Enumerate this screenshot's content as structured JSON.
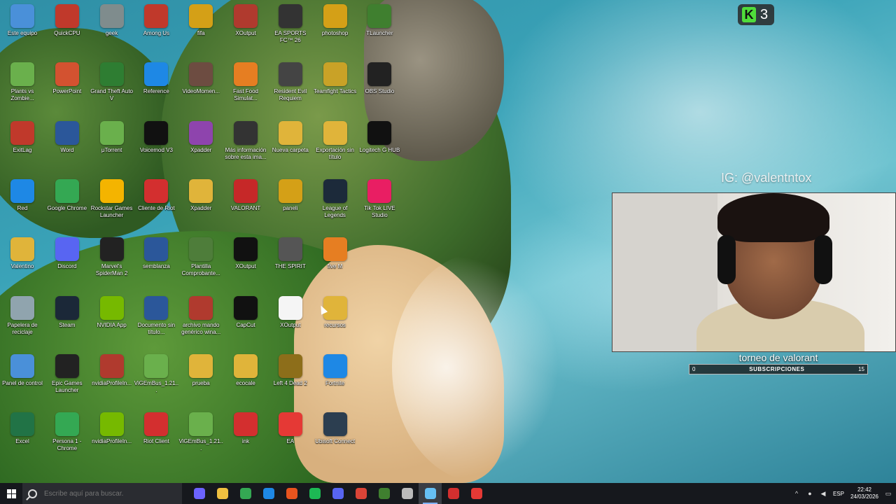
{
  "desktop": {
    "icons": [
      {
        "label": "Este equipo",
        "color": "#4a90d9",
        "icon": "computer-icon"
      },
      {
        "label": "QuickCPU",
        "color": "#c0392b",
        "icon": "quickcpu-icon"
      },
      {
        "label": "geek",
        "color": "#7f8c8d",
        "icon": "geek-icon"
      },
      {
        "label": "Among Us",
        "color": "#c0392b",
        "icon": "among-us-icon"
      },
      {
        "label": "fifa",
        "color": "#d4a017",
        "icon": "archive-icon"
      },
      {
        "label": "XOutput",
        "color": "#b03a2e",
        "icon": "archive-icon"
      },
      {
        "label": "EA SPORTS FC™ 26",
        "color": "#333333",
        "icon": "fc26-icon"
      },
      {
        "label": "photoshop",
        "color": "#d4a017",
        "icon": "archive-icon"
      },
      {
        "label": "TLauncher",
        "color": "#3f7f2f",
        "icon": "tlauncher-icon"
      },
      {
        "label": "Plants vs Zombie...",
        "color": "#6ab04c",
        "icon": "pvz-icon"
      },
      {
        "label": "PowerPoint",
        "color": "#d35230",
        "icon": "powerpoint-icon"
      },
      {
        "label": "Grand Theft Auto V",
        "color": "#2e7d32",
        "icon": "gta-icon"
      },
      {
        "label": "Reference",
        "color": "#1e88e5",
        "icon": "edge-icon"
      },
      {
        "label": "VideoMomen...",
        "color": "#6d4c41",
        "icon": "video-icon"
      },
      {
        "label": "Fast Food Simulat...",
        "color": "#e67e22",
        "icon": "game-icon"
      },
      {
        "label": "Resident Evil Requiem",
        "color": "#444444",
        "icon": "game-icon"
      },
      {
        "label": "Teamfight Tactics",
        "color": "#c9a227",
        "icon": "tft-icon"
      },
      {
        "label": "OBS Studio",
        "color": "#222222",
        "icon": "obs-icon"
      },
      {
        "label": "ExitLag",
        "color": "#c0392b",
        "icon": "exitlag-icon"
      },
      {
        "label": "Word",
        "color": "#2b579a",
        "icon": "word-icon"
      },
      {
        "label": "μTorrent",
        "color": "#6ab04c",
        "icon": "utorrent-icon"
      },
      {
        "label": "Voicemod V3",
        "color": "#111111",
        "icon": "voicemod-icon"
      },
      {
        "label": "Xpadder",
        "color": "#8e44ad",
        "icon": "archive-icon"
      },
      {
        "label": "Más información sobre esta ima...",
        "color": "#333333",
        "icon": "info-icon"
      },
      {
        "label": "Nueva carpeta",
        "color": "#e0b43a",
        "icon": "folder-icon"
      },
      {
        "label": "Exportación sin título",
        "color": "#e0b43a",
        "icon": "folder-icon"
      },
      {
        "label": "Logitech G HUB",
        "color": "#111111",
        "icon": "logitech-icon"
      },
      {
        "label": "Red",
        "color": "#1e88e5",
        "icon": "network-icon"
      },
      {
        "label": "Google Chrome",
        "color": "#34a853",
        "icon": "chrome-icon"
      },
      {
        "label": "Rockstar Games Launcher",
        "color": "#f4b400",
        "icon": "rockstar-icon"
      },
      {
        "label": "Cliente de Riot",
        "color": "#d32f2f",
        "icon": "riot-icon"
      },
      {
        "label": "Xpadder",
        "color": "#e0b43a",
        "icon": "folder-icon"
      },
      {
        "label": "VALORANT",
        "color": "#c62828",
        "icon": "valorant-icon"
      },
      {
        "label": "paneli",
        "color": "#d4a017",
        "icon": "archive-icon"
      },
      {
        "label": "League of Legends",
        "color": "#1c2a3a",
        "icon": "lol-icon"
      },
      {
        "label": "Tik Tok LIVE Studio",
        "color": "#e91e63",
        "icon": "tiktok-icon"
      },
      {
        "label": "Valentino",
        "color": "#e0b43a",
        "icon": "folder-icon"
      },
      {
        "label": "Discord",
        "color": "#5865f2",
        "icon": "discord-icon"
      },
      {
        "label": "Marvel's SpiderMan 2",
        "color": "#222222",
        "icon": "spiderman-icon"
      },
      {
        "label": "semblanza",
        "color": "#2b579a",
        "icon": "word-doc-icon"
      },
      {
        "label": "Plantilla Comprobante...",
        "color": "#4e7d3a",
        "icon": "file-icon"
      },
      {
        "label": "XOutput",
        "color": "#111111",
        "icon": "x-icon"
      },
      {
        "label": "THE SPIRIT",
        "color": "#555555",
        "icon": "game-icon"
      },
      {
        "label": "five M",
        "color": "#e67e22",
        "icon": "fivem-icon"
      },
      {
        "label": "Papelera de reciclaje",
        "color": "#90a4ae",
        "icon": "recycle-bin-icon"
      },
      {
        "label": "Steam",
        "color": "#1b2838",
        "icon": "steam-icon"
      },
      {
        "label": "NVIDIA App",
        "color": "#76b900",
        "icon": "nvidia-icon"
      },
      {
        "label": "Documento sin título...",
        "color": "#2b579a",
        "icon": "word-doc-icon"
      },
      {
        "label": "archivo mando genérico wina...",
        "color": "#b03a2e",
        "icon": "archive-icon"
      },
      {
        "label": "CapCut",
        "color": "#111111",
        "icon": "capcut-icon"
      },
      {
        "label": "XOutput",
        "color": "#f5f5f5",
        "icon": "file-icon"
      },
      {
        "label": "recursos",
        "color": "#e0b43a",
        "icon": "folder-icon"
      },
      {
        "label": "Panel de control",
        "color": "#4a90d9",
        "icon": "control-panel-icon"
      },
      {
        "label": "Epic Games Launcher",
        "color": "#222222",
        "icon": "epic-icon"
      },
      {
        "label": "nvidiaProfileIn...",
        "color": "#b03a2e",
        "icon": "archive-icon"
      },
      {
        "label": "ViGEmBus_1.21...",
        "color": "#6ab04c",
        "icon": "controller-icon"
      },
      {
        "label": "prueba",
        "color": "#e0b43a",
        "icon": "folder-icon"
      },
      {
        "label": "ecocale",
        "color": "#e0b43a",
        "icon": "folder-icon"
      },
      {
        "label": "Left 4 Dead 2",
        "color": "#8d6e1a",
        "icon": "game-icon"
      },
      {
        "label": "Fortnite",
        "color": "#1e88e5",
        "icon": "fortnite-icon"
      },
      {
        "label": "Excel",
        "color": "#217346",
        "icon": "excel-icon"
      },
      {
        "label": "Persona 1 - Chrome",
        "color": "#34a853",
        "icon": "chrome-icon"
      },
      {
        "label": "nvidiaProfileIn...",
        "color": "#76b900",
        "icon": "nvidia-icon"
      },
      {
        "label": "Riot Client",
        "color": "#d32f2f",
        "icon": "riot-icon"
      },
      {
        "label": "ViGEmBus_1.21...",
        "color": "#6ab04c",
        "icon": "controller-icon"
      },
      {
        "label": "ink",
        "color": "#d32f2f",
        "icon": "riot-icon"
      },
      {
        "label": "EA",
        "color": "#e53935",
        "icon": "ea-icon"
      },
      {
        "label": "Ubisoft Connect",
        "color": "#2c3e50",
        "icon": "ubisoft-icon"
      }
    ]
  },
  "overlay": {
    "badge_letter": "K",
    "badge_count": "3",
    "handle": "IG: @valentntox",
    "sub_title": "torneo de valorant",
    "sub_current": "0",
    "sub_label": "SUBSCRIPCIONES",
    "sub_goal": "15"
  },
  "taskbar": {
    "search_placeholder": "Escribe aquí para buscar.",
    "apps": [
      {
        "name": "copilot-icon",
        "color": "#6c63ff",
        "active": false
      },
      {
        "name": "file-explorer-icon",
        "color": "#f0c040",
        "active": false
      },
      {
        "name": "chrome-icon",
        "color": "#34a853",
        "active": false
      },
      {
        "name": "store-icon",
        "color": "#1e88e5",
        "active": false
      },
      {
        "name": "brave-icon",
        "color": "#e8541e",
        "active": false
      },
      {
        "name": "spotify-icon",
        "color": "#1db954",
        "active": false
      },
      {
        "name": "discord-icon",
        "color": "#5865f2",
        "active": false
      },
      {
        "name": "chrome-profile-icon",
        "color": "#db4437",
        "active": false
      },
      {
        "name": "minecraft-icon",
        "color": "#3f7f2f",
        "active": false
      },
      {
        "name": "settings-icon",
        "color": "#bbbbbb",
        "active": false
      },
      {
        "name": "steam-icon",
        "color": "#66c0f4",
        "active": true
      },
      {
        "name": "riot-vanguard-icon",
        "color": "#d32f2f",
        "active": false
      },
      {
        "name": "recording-icon",
        "color": "#e53935",
        "active": false
      }
    ],
    "tray": {
      "language": "ESP",
      "time": "22:42",
      "date": "24/03/2026"
    }
  }
}
